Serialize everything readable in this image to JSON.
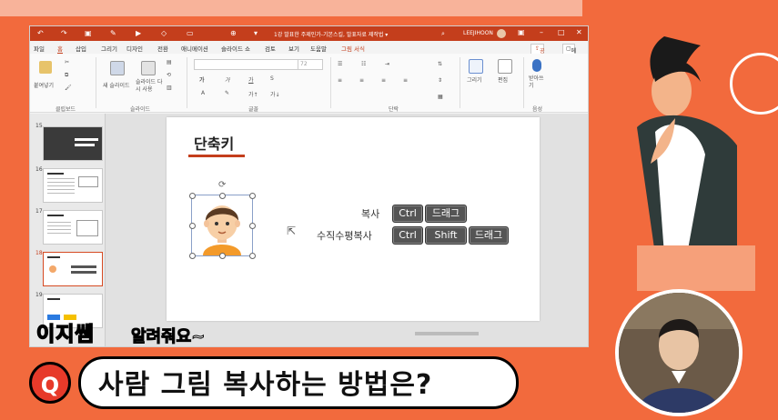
{
  "titlebar": {
    "title": "1강 발표한 주제인가-기본스킬, 발표자료 제작법 ▾",
    "user": "LEEJIHOON",
    "qa_icons": [
      "undo-icon",
      "redo-icon",
      "save-icon"
    ]
  },
  "menu": {
    "items": [
      "파일",
      "홈",
      "삽입",
      "그리기",
      "디자인",
      "전환",
      "애니메이션",
      "슬라이드 쇼",
      "검토",
      "보기",
      "도움말",
      "그림 서식"
    ],
    "active_index": 1,
    "share": "공유",
    "memo": "메모"
  },
  "ribbon": {
    "paste": "붙여넣기",
    "new_slide": "새 슬라이드",
    "reuse_slide": "슬라이드 다시 사용",
    "font_size": "72",
    "groups": [
      "클립보드",
      "슬라이드",
      "글꼴",
      "단락",
      "그리기",
      "편집",
      "음성"
    ],
    "draw": "그리기",
    "edit": "편집",
    "dictate": "받아쓰기"
  },
  "thumbnails": [
    {
      "num": "15"
    },
    {
      "num": "16"
    },
    {
      "num": "17"
    },
    {
      "num": "18"
    },
    {
      "num": "19"
    }
  ],
  "slide": {
    "title": "단축키",
    "rows": [
      {
        "label": "복사",
        "keys": [
          "Ctrl",
          "드래그"
        ]
      },
      {
        "label": "수직수평복사",
        "keys": [
          "Ctrl",
          "Shift",
          "드래그"
        ]
      }
    ]
  },
  "caption": {
    "series_a": "이지쌤",
    "series_b": "알려줘요~",
    "q_mark": "Q",
    "question": "사람 그림 복사하는 방법은?"
  },
  "colors": {
    "accent": "#c43e1c",
    "background": "#f26a3d",
    "caption_yellow": "#ffd400"
  }
}
